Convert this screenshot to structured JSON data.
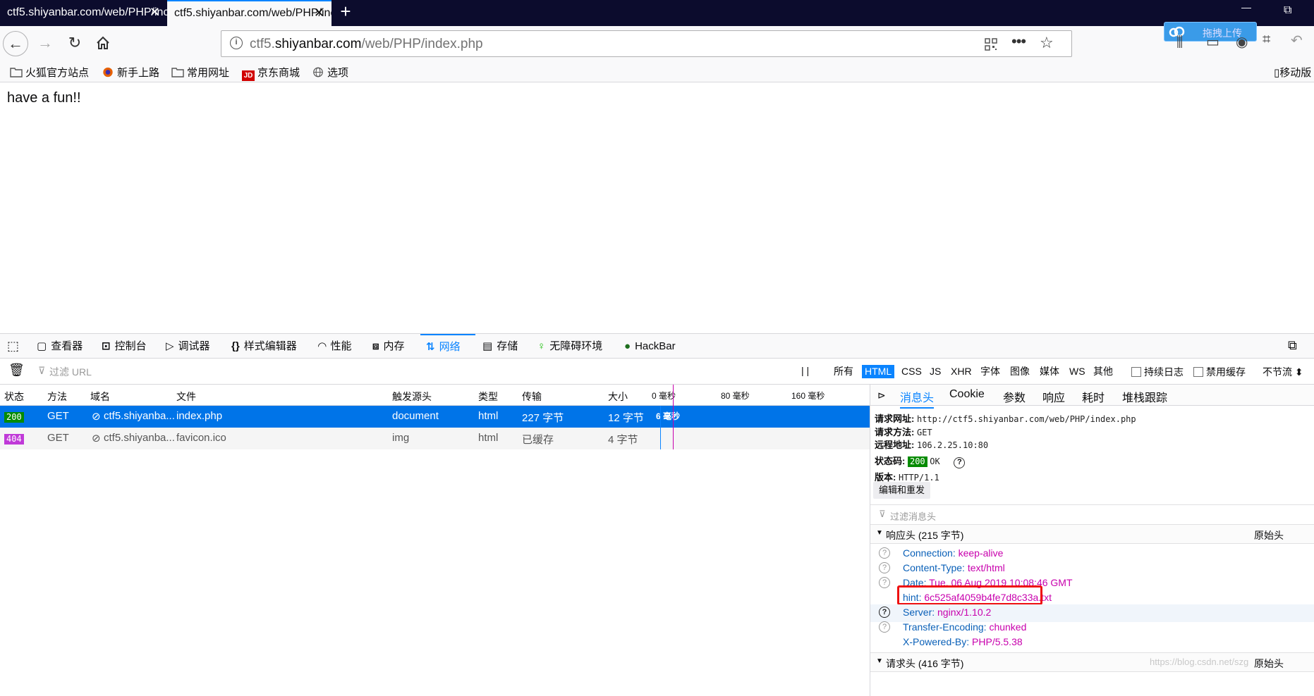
{
  "tabs": [
    {
      "title": "ctf5.shiyanbar.com/web/PHP/inc",
      "close": "✕"
    },
    {
      "title": "ctf5.shiyanbar.com/web/PHP/inc",
      "close": "✕"
    }
  ],
  "new_tab": "+",
  "window": {
    "minimize": "—",
    "restore": "⧉"
  },
  "url": {
    "host_pre": "ctf5.",
    "host": "shiyanbar.com",
    "path": "/web/PHP/index.php"
  },
  "upload_btn": "拖拽上传",
  "bookmarks": [
    "火狐官方站点",
    "新手上路",
    "常用网址",
    "京东商城",
    "选项"
  ],
  "bookmarks_right": "移动版",
  "page_text": "have a fun!!",
  "devtools": {
    "tabs": [
      "查看器",
      "控制台",
      "调试器",
      "样式编辑器",
      "性能",
      "内存",
      "网络",
      "存储",
      "无障碍环境",
      "HackBar"
    ],
    "filter_placeholder": "过滤 URL",
    "pause": "| |",
    "types": [
      "所有",
      "HTML",
      "CSS",
      "JS",
      "XHR",
      "字体",
      "图像",
      "媒体",
      "WS",
      "其他"
    ],
    "persist_log": "持续日志",
    "disable_cache": "禁用缓存",
    "throttle": "不节流 ⬍",
    "columns": [
      "状态",
      "方法",
      "域名",
      "文件",
      "触发源头",
      "类型",
      "传输",
      "大小"
    ],
    "timeline_ticks": [
      "0 毫秒",
      "80 毫秒",
      "160 毫秒"
    ],
    "rows": [
      {
        "status": "200",
        "method": "GET",
        "domain": "ctf5.shiyanba...",
        "file": "index.php",
        "cause": "document",
        "type": "html",
        "transferred": "227 字节",
        "size": "12 字节",
        "time": "6 毫秒"
      },
      {
        "status": "404",
        "method": "GET",
        "domain": "ctf5.shiyanba...",
        "file": "favicon.ico",
        "cause": "img",
        "type": "html",
        "transferred": "已缓存",
        "size": "4 字节",
        "time": ""
      }
    ],
    "side": {
      "tabs": [
        "消息头",
        "Cookie",
        "参数",
        "响应",
        "耗时",
        "堆栈跟踪"
      ],
      "request_url_label": "请求网址:",
      "request_url": "http://ctf5.shiyanbar.com/web/PHP/index.php",
      "method_label": "请求方法:",
      "method": "GET",
      "remote_label": "远程地址:",
      "remote": "106.2.25.10:80",
      "status_label": "状态码:",
      "status_code": "200",
      "status_text": "OK",
      "version_label": "版本:",
      "version": "HTTP/1.1",
      "edit_resend": "编辑和重发",
      "filter_headers": "过滤消息头",
      "response_headers": "响应头 (215 字节)",
      "raw_headers": "原始头",
      "headers": [
        {
          "name": "Connection:",
          "value": "keep-alive"
        },
        {
          "name": "Content-Type:",
          "value": "text/html"
        },
        {
          "name": "Date:",
          "value": "Tue, 06 Aug 2019 10:08:46 GMT"
        },
        {
          "name": "hint:",
          "value": "6c525af4059b4fe7d8c33a.txt"
        },
        {
          "name": "Server:",
          "value": "nginx/1.10.2"
        },
        {
          "name": "Transfer-Encoding:",
          "value": "chunked"
        },
        {
          "name": "X-Powered-By:",
          "value": "PHP/5.5.38"
        }
      ],
      "request_headers": "请求头 (416 字节)",
      "watermark": "https://blog.csdn.net/szg"
    }
  },
  "colors": {
    "accent": "#0a84ff",
    "ok_green": "#058b00",
    "err_purple": "#c03ad8",
    "highlight_red": "#e11"
  }
}
